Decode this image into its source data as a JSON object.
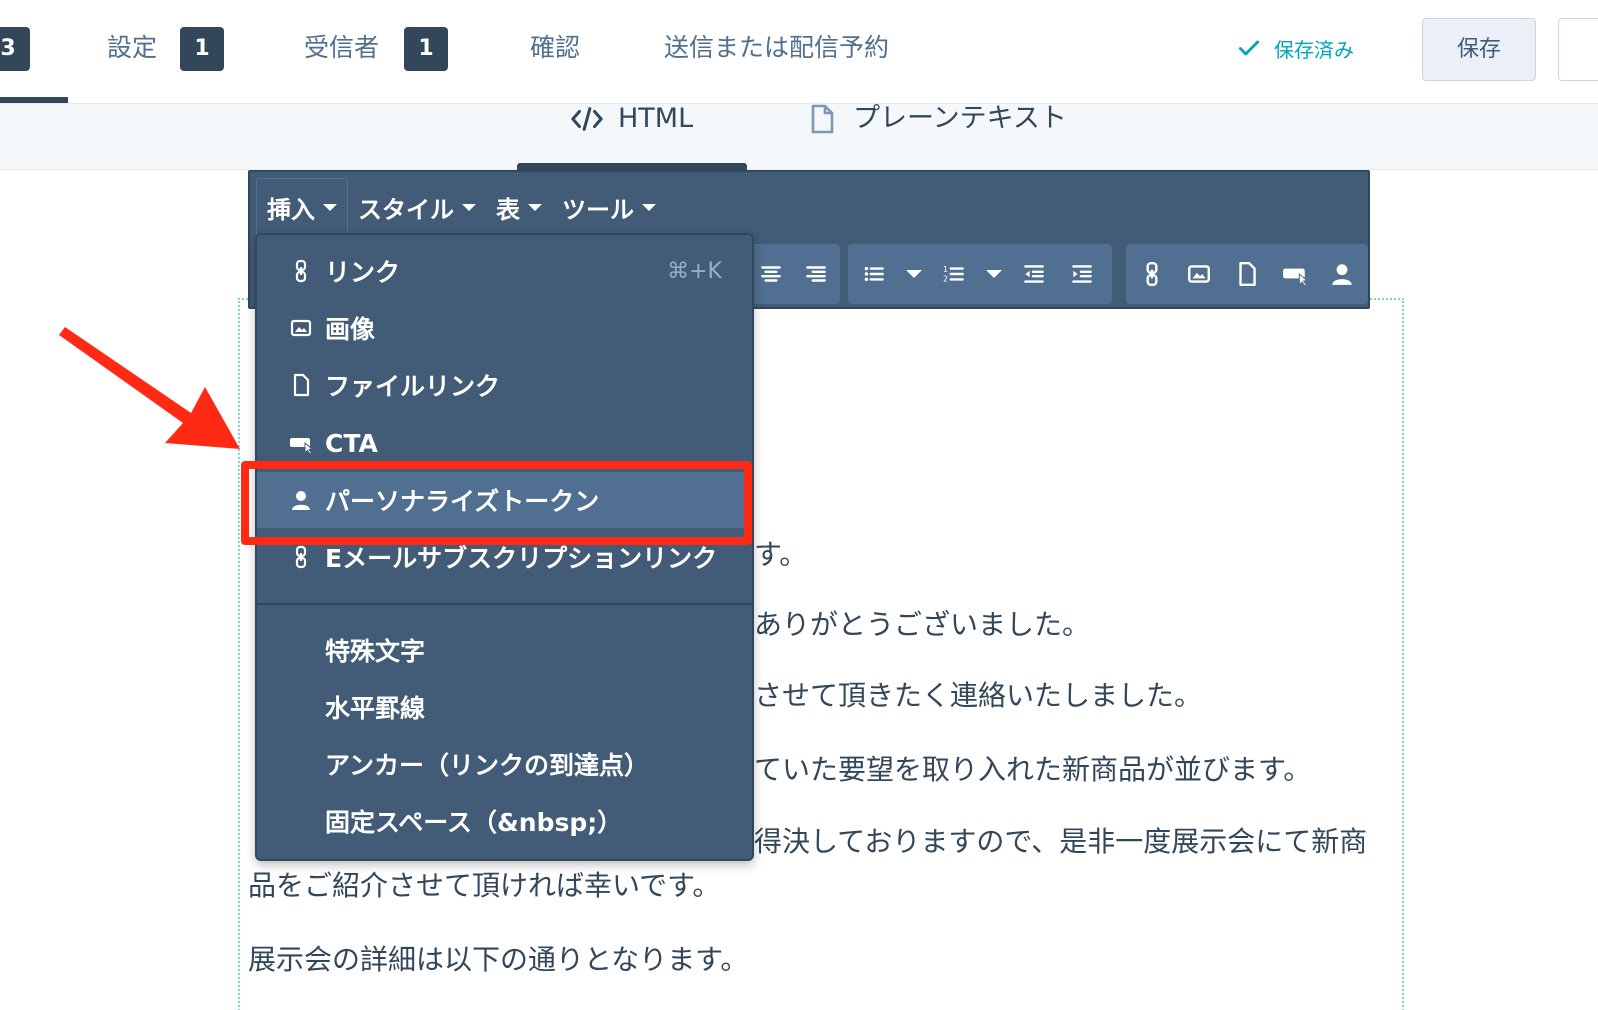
{
  "nav": {
    "current_step_badge": "3",
    "steps": [
      {
        "label": "設定",
        "badge": "1"
      },
      {
        "label": "受信者",
        "badge": "1"
      },
      {
        "label": "確認"
      },
      {
        "label": "送信または配信予約"
      }
    ],
    "saved_status": "保存済み",
    "save_button": "保存"
  },
  "editor_tabs": [
    {
      "label": "HTML",
      "icon": "code-icon"
    },
    {
      "label": "プレーンテキスト",
      "icon": "document-icon"
    }
  ],
  "toolbar": {
    "menus": [
      "挿入",
      "スタイル",
      "表",
      "ツール"
    ],
    "icons": [
      "align-center-icon",
      "align-right-icon",
      "bulleted-list-icon",
      "numbered-list-icon",
      "outdent-icon",
      "indent-icon",
      "link-icon",
      "image-icon",
      "file-icon",
      "cta-icon",
      "personalize-icon"
    ]
  },
  "insert_menu": {
    "items": [
      {
        "label": "リンク",
        "icon": "link-icon",
        "shortcut": "⌘+K"
      },
      {
        "label": "画像",
        "icon": "image-icon"
      },
      {
        "label": "ファイルリンク",
        "icon": "file-icon"
      },
      {
        "label": "CTA",
        "icon": "cta-icon"
      },
      {
        "label": "パーソナライズトークン",
        "icon": "person-icon",
        "highlighted": true
      },
      {
        "label": "Eメールサブスクリプションリンク",
        "icon": "link-icon"
      }
    ],
    "extra_items": [
      {
        "label": "特殊文字"
      },
      {
        "label": "水平罫線"
      },
      {
        "label": "アンカー（リンクの到達点）"
      },
      {
        "label": "固定スペース（&nbsp;）"
      }
    ]
  },
  "email_body": {
    "line1_tail": "す。",
    "line2_tail": "ありがとうございました。",
    "line3_tail": "させて頂きたく連絡いたしました。",
    "line4_tail": "ていた要望を取り入れた新商品が並びます。",
    "line5_tail": "得決しておりますので、是非一度展示会にて新商",
    "line6": "品をご紹介させて頂ければ幸いです。",
    "line7": "展示会の詳細は以下の通りとなります。"
  },
  "colors": {
    "toolbar": "#425b76",
    "accent_teal": "#00a4bd",
    "annotation_red": "#ff2a14"
  }
}
